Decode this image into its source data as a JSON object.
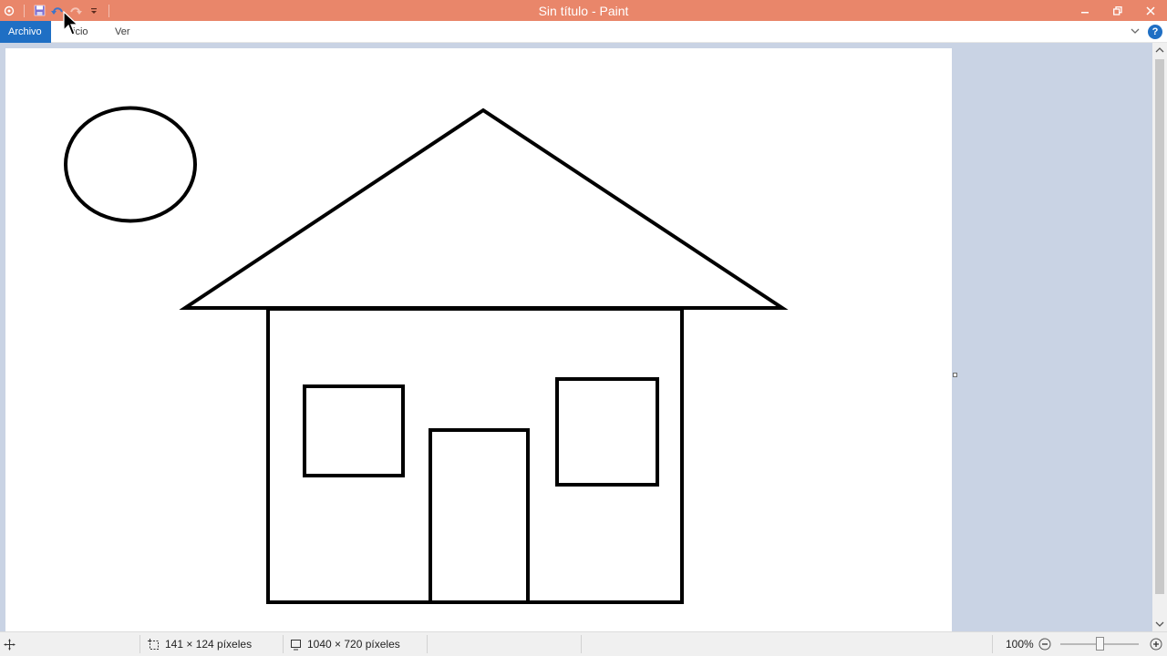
{
  "window": {
    "title": "Sin título - Paint"
  },
  "ribbon": {
    "tabs": [
      {
        "label": "Archivo"
      },
      {
        "label": "Inicio"
      },
      {
        "label": "Ver"
      }
    ],
    "visible_home_tab_text": "icio"
  },
  "status": {
    "selection_size": "141 × 124 píxeles",
    "image_size": "1040 × 720 píxeles",
    "zoom": "100%"
  },
  "colors": {
    "titlebar": "#e9866a",
    "file_tab": "#1f6fc4",
    "workspace": "#c9d3e4",
    "stroke": "#000000"
  },
  "icons": [
    "paint-app-icon",
    "save-icon",
    "undo-icon",
    "redo-icon",
    "customize-qat-icon",
    "minimize-icon",
    "restore-icon",
    "close-icon",
    "collapse-ribbon-icon",
    "help-icon",
    "cursor-position-icon",
    "selection-size-icon",
    "image-size-icon",
    "zoom-out-icon",
    "zoom-in-icon"
  ]
}
